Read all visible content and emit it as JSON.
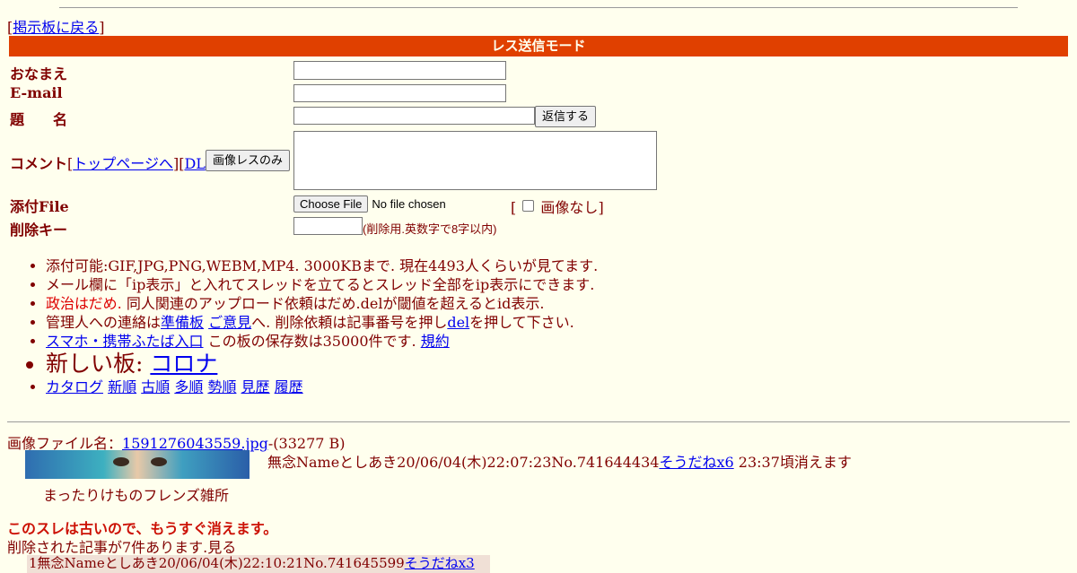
{
  "nav": {
    "back_link": "掲示板に戻る"
  },
  "form": {
    "banner": "レス送信モード",
    "name_label": "おなまえ",
    "email_label": "E-mail",
    "subject_label": "題　　名",
    "submit_button": "返信する",
    "comment_label": "コメント",
    "toppage_link": "トップページへ",
    "dl_link": "DL",
    "image_only_button": "画像レスのみ",
    "file_label": "添付File",
    "choose_file_button": "Choose File",
    "no_file_text": "No file chosen",
    "no_image_label": "画像なし",
    "delkey_label": "削除キー",
    "delkey_note": "(削除用.英数字で8字以内)"
  },
  "notes": {
    "line1": "添付可能:GIF,JPG,PNG,WEBM,MP4. 3000KBまで. 現在4493人くらいが見てます.",
    "line2": "メール欄に「ip表示」と入れてスレッドを立てるとスレッド全部をip表示にできます.",
    "line3_red": "政治はだめ.",
    "line3_rest": " 同人関連のアップロード依頼はだめ.delが閾値を超えるとid表示.",
    "line4_a": "管理人への連絡は",
    "line4_link1": "準備板",
    "line4_link2": "ご意見",
    "line4_b": "へ. 削除依頼は記事番号を押し",
    "line4_link3": "del",
    "line4_c": "を押して下さい.",
    "line5_link": "スマホ・携帯ふたば入口",
    "line5_text": " この板の保存数は35000件です. ",
    "line5_link2": "規約",
    "new_board_label": "新しい板: ",
    "new_board_link": "コロナ",
    "links": [
      "カタログ",
      "新順",
      "古順",
      "多順",
      "勢順",
      "見歴",
      "履歴"
    ]
  },
  "thread": {
    "file_label": "画像ファイル名：",
    "file_name": "1591276043559.jpg",
    "file_size": "-(33277 B)",
    "caption": "まったりけものフレンズ雑所",
    "op_header": "無念Nameとしあき20/06/04(木)22:07:23No.741644434",
    "op_sodane": "そうだねx6",
    "op_expire": " 23:37頃消えます",
    "old_warning": "このスレは古いので、もうすぐ消えます。",
    "deleted_notice": "削除された記事が7件あります.見る",
    "reply1_header": "1無念Nameとしあき20/06/04(木)22:10:21No.741645599",
    "reply1_sodane": "そうだねx3"
  },
  "colors": {
    "banner": "#e04000",
    "background": "#ffffee",
    "text": "#800000",
    "reply_bg": "#f0e0d6"
  }
}
